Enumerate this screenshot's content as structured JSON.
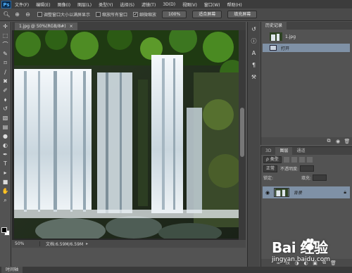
{
  "app": {
    "logo": "Ps"
  },
  "menubar": {
    "items": [
      "文件(F)",
      "编辑(E)",
      "图像(I)",
      "图层(L)",
      "类型(Y)",
      "选择(S)",
      "滤镜(T)",
      "3D(D)",
      "视图(V)",
      "窗口(W)",
      "帮助(H)"
    ]
  },
  "options": {
    "resize_windows_label": "调整窗口大小以满屏显示",
    "resize_windows_checked": false,
    "zoom_all_label": "缩放所有窗口",
    "zoom_all_checked": false,
    "scrubby_zoom_label": "细微缩放",
    "scrubby_zoom_checked": true,
    "btn_100": "100%",
    "btn_fit_screen": "适合屏幕",
    "btn_fill_screen": "填充屏幕"
  },
  "document": {
    "tab_title": "1.jpg @ 50%(RGB/8#)",
    "close_glyph": "×",
    "zoom": "50%",
    "doc_size": "文档:6.59M/6.59M"
  },
  "history_panel": {
    "tabs": [
      "历史记录"
    ],
    "snapshot_name": "1.jpg",
    "states": [
      "打开"
    ]
  },
  "layers_panel": {
    "tabs": [
      "3D",
      "图层",
      "通道"
    ],
    "active_tab": "图层",
    "filter_kind": "ρ 类型",
    "blend_mode": "正常",
    "opacity_label": "不透明度:",
    "lock_label": "锁定:",
    "fill_label": "填充:",
    "layers": [
      {
        "name": "背景",
        "visible": true,
        "locked": true
      }
    ]
  },
  "bottom": {
    "timeline_tab": "时间轴"
  },
  "watermark": {
    "brand": "Bai 经验",
    "url": "jingyan.baidu.com"
  },
  "icons": {
    "options": [
      "zoom-tool-icon",
      "zoom-in-icon",
      "zoom-out-icon"
    ],
    "tools": [
      "move-icon",
      "marquee-icon",
      "lasso-icon",
      "quick-select-icon",
      "crop-icon",
      "eyedropper-icon",
      "healing-brush-icon",
      "brush-icon",
      "clone-stamp-icon",
      "history-brush-icon",
      "eraser-icon",
      "gradient-icon",
      "blur-icon",
      "dodge-icon",
      "pen-icon",
      "type-icon",
      "path-select-icon",
      "rectangle-shape-icon",
      "hand-icon",
      "zoom-icon"
    ],
    "dock": [
      "history-icon",
      "info-icon",
      "character-icon",
      "paragraph-icon",
      "tools-preset-icon"
    ]
  },
  "colors": {
    "selection": "#7f91a6",
    "panel": "#535353",
    "brand_blue": "#4fb2ff"
  }
}
